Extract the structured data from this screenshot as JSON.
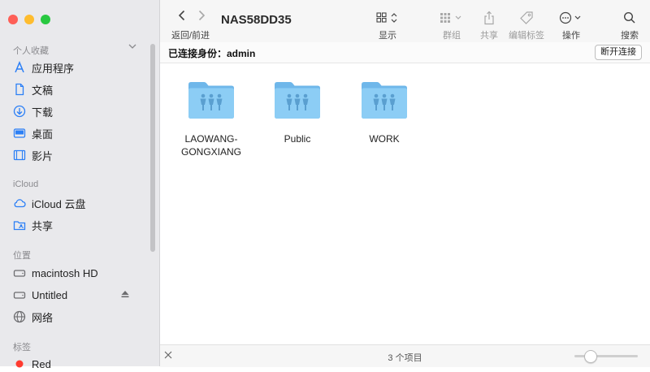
{
  "window": {
    "title": "NAS58DD35",
    "nav_label": "返回/前进"
  },
  "sidebar": {
    "sections": {
      "favorites": "个人收藏",
      "icloud": "iCloud",
      "locations": "位置",
      "tags": "标签"
    },
    "favorites": [
      {
        "label": "应用程序",
        "icon": "applications-icon"
      },
      {
        "label": "文稿",
        "icon": "document-icon"
      },
      {
        "label": "下载",
        "icon": "download-icon"
      },
      {
        "label": "桌面",
        "icon": "desktop-icon"
      },
      {
        "label": "影片",
        "icon": "film-icon"
      }
    ],
    "icloud": [
      {
        "label": "iCloud 云盘",
        "icon": "cloud-icon"
      },
      {
        "label": "共享",
        "icon": "shared-folder-icon"
      }
    ],
    "locations": [
      {
        "label": "macintosh HD",
        "icon": "disk-icon"
      },
      {
        "label": "Untitled",
        "icon": "disk-icon"
      },
      {
        "label": "网络",
        "icon": "globe-icon"
      }
    ],
    "tags": [
      {
        "label": "Red",
        "color": "#ff3b30"
      }
    ]
  },
  "toolbar": {
    "display_label": "显示",
    "group_label": "群组",
    "share_label": "共享",
    "edit_tags_label": "编辑标签",
    "action_label": "操作",
    "search_label": "搜索"
  },
  "connection": {
    "label": "已连接身份：admin",
    "disconnect_label": "断开连接"
  },
  "files": [
    {
      "name": "LAOWANG-GONGXIANG"
    },
    {
      "name": "Public"
    },
    {
      "name": "WORK"
    }
  ],
  "status": {
    "item_count": "3 个项目"
  },
  "colors": {
    "folder": "#7ec3ee",
    "accent": "#2b7ff6"
  }
}
